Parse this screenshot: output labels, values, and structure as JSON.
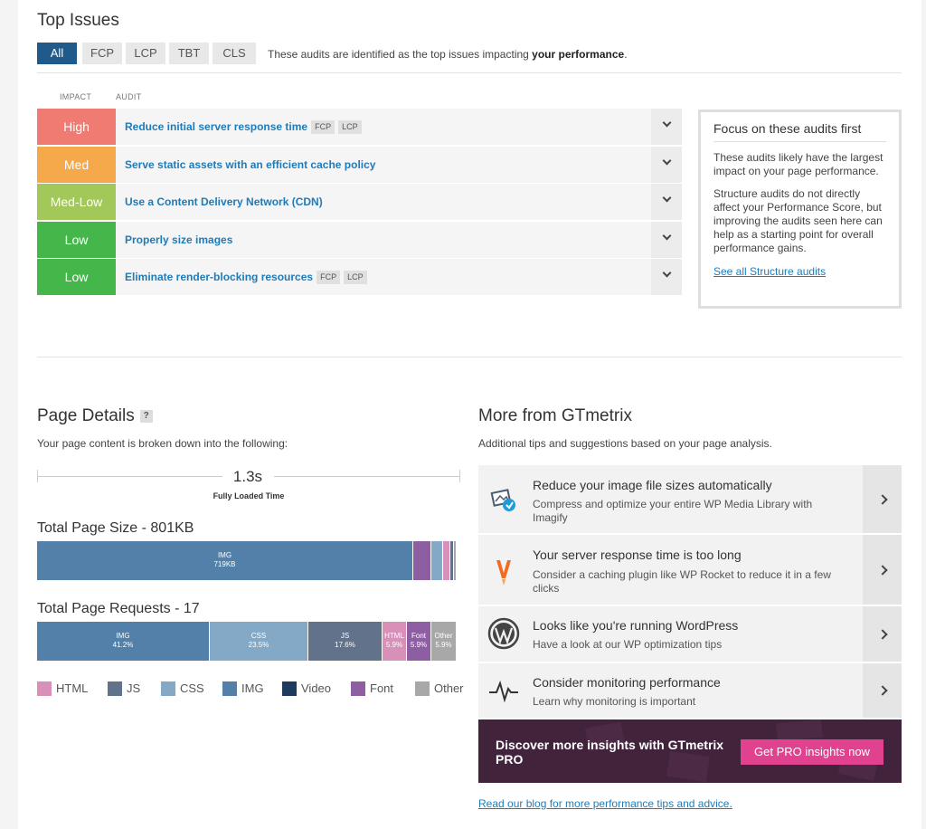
{
  "top_issues": {
    "title": "Top Issues",
    "filters": [
      "All",
      "FCP",
      "LCP",
      "TBT",
      "CLS"
    ],
    "active_filter": "All",
    "description_prefix": "These audits are identified as the top issues impacting ",
    "description_bold": "your performance",
    "description_suffix": ".",
    "columns": {
      "impact": "IMPACT",
      "audit": "AUDIT"
    },
    "audits": [
      {
        "impact": "High",
        "color": "#ef7b73",
        "title": "Reduce initial server response time",
        "tags": [
          "FCP",
          "LCP"
        ]
      },
      {
        "impact": "Med",
        "color": "#f5a94a",
        "title": "Serve static assets with an efficient cache policy",
        "tags": []
      },
      {
        "impact": "Med-Low",
        "color": "#a3c85a",
        "title": "Use a Content Delivery Network (CDN)",
        "tags": []
      },
      {
        "impact": "Low",
        "color": "#45b649",
        "title": "Properly size images",
        "tags": []
      },
      {
        "impact": "Low",
        "color": "#45b649",
        "title": "Eliminate render-blocking resources",
        "tags": [
          "FCP",
          "LCP"
        ]
      }
    ],
    "focus": {
      "title": "Focus on these audits first",
      "p1": "These audits likely have the largest impact on your page performance.",
      "p2": "Structure audits do not directly affect your Performance Score, but improving the audits seen here can help as a starting point for overall performance gains.",
      "link": "See all Structure audits"
    }
  },
  "page_details": {
    "title": "Page Details",
    "help": "?",
    "subtitle": "Your page content is broken down into the following:",
    "fully_loaded_value": "1.3s",
    "fully_loaded_label": "Fully Loaded Time",
    "size_title": "Total Page Size - 801KB",
    "size_bar": [
      {
        "type": "IMG",
        "value": "719KB",
        "fraction": 0.8976,
        "color": "#5280a8"
      },
      {
        "type": "Font",
        "value": "",
        "fraction": 0.044,
        "color": "#8e5ea2"
      },
      {
        "type": "CSS",
        "value": "",
        "fraction": 0.027,
        "color": "#84a9c7"
      },
      {
        "type": "HTML",
        "value": "",
        "fraction": 0.018,
        "color": "#d88fb8"
      },
      {
        "type": "JS",
        "value": "",
        "fraction": 0.008,
        "color": "#62728a"
      },
      {
        "type": "Other",
        "value": "",
        "fraction": 0.0054,
        "color": "#a8a8a8"
      }
    ],
    "requests_title": "Total Page Requests - 17",
    "requests_bar": [
      {
        "type": "IMG",
        "value": "41.2%",
        "fraction": 0.412,
        "color": "#5280a8"
      },
      {
        "type": "CSS",
        "value": "23.5%",
        "fraction": 0.235,
        "color": "#84a9c7"
      },
      {
        "type": "JS",
        "value": "17.6%",
        "fraction": 0.176,
        "color": "#62728a"
      },
      {
        "type": "HTML",
        "value": "5.9%",
        "fraction": 0.059,
        "color": "#d88fb8"
      },
      {
        "type": "Font",
        "value": "5.9%",
        "fraction": 0.059,
        "color": "#8e5ea2"
      },
      {
        "type": "Other",
        "value": "5.9%",
        "fraction": 0.059,
        "color": "#a8a8a8"
      }
    ],
    "legend": [
      {
        "label": "HTML",
        "color": "#d88fb8"
      },
      {
        "label": "JS",
        "color": "#62728a"
      },
      {
        "label": "CSS",
        "color": "#84a9c7"
      },
      {
        "label": "IMG",
        "color": "#5280a8"
      },
      {
        "label": "Video",
        "color": "#1d3b5e"
      },
      {
        "label": "Font",
        "color": "#8e5ea2"
      },
      {
        "label": "Other",
        "color": "#a8a8a8"
      }
    ]
  },
  "more": {
    "title": "More from GTmetrix",
    "subtitle": "Additional tips and suggestions based on your page analysis.",
    "tips": [
      {
        "icon": "image-optimize-icon",
        "title": "Reduce your image file sizes automatically",
        "desc": "Compress and optimize your entire WP Media Library with Imagify"
      },
      {
        "icon": "wp-rocket-icon",
        "title": "Your server response time is too long",
        "desc": "Consider a caching plugin like WP Rocket to reduce it in a few clicks"
      },
      {
        "icon": "wordpress-icon",
        "title": "Looks like you're running WordPress",
        "desc": "Have a look at our WP optimization tips"
      },
      {
        "icon": "pulse-icon",
        "title": "Consider monitoring performance",
        "desc": "Learn why monitoring is important"
      }
    ],
    "promo_text": "Discover more insights with GTmetrix PRO",
    "promo_button": "Get PRO insights now",
    "blog_link": "Read our blog for more performance tips and advice."
  }
}
